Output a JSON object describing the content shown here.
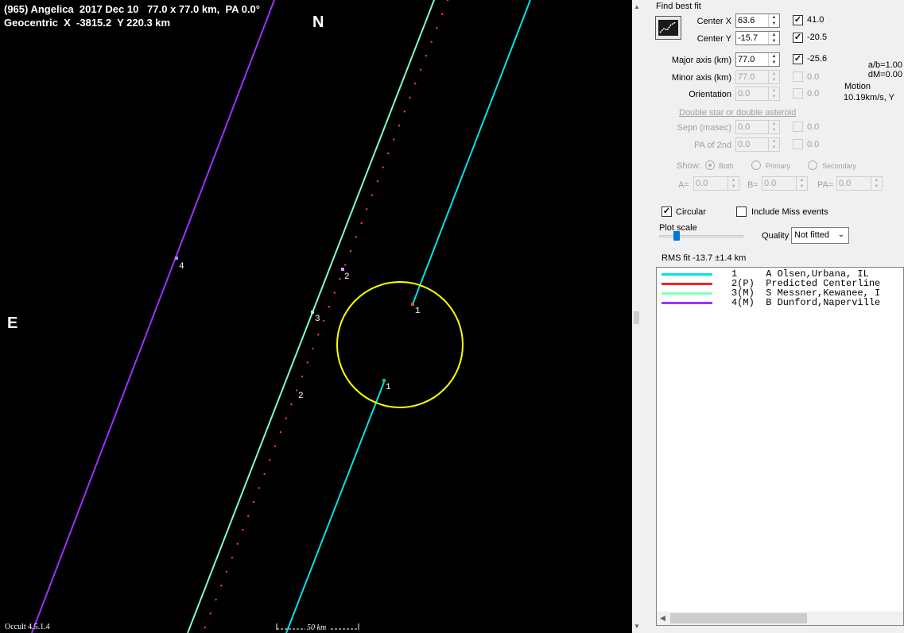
{
  "plot": {
    "title_line1": "(965) Angelica  2017 Dec 10   77.0 x 77.0 km,  PA 0.0°",
    "title_line2": "Geocentric  X  -3815.2  Y 220.3 km",
    "north": "N",
    "east": "E",
    "version": "Occult 4.5.1.4",
    "scale_label": "50 km",
    "chord_labels": {
      "chord4": "4",
      "chord3": "3",
      "pred_top": "2",
      "pred_bottom": "2",
      "chord1_top": "1",
      "chord1_bottom": "1"
    },
    "colors": {
      "chord1": "#00e5e5",
      "predicted": "#ff3030",
      "chord3": "#7fffc4",
      "chord4": "#9933ff",
      "ellipse": "#ffff00"
    }
  },
  "panel": {
    "find_best_fit": "Find best fit",
    "center_x": {
      "label": "Center X",
      "value": "63.6",
      "checked": true,
      "fit": "41.0"
    },
    "center_y": {
      "label": "Center Y",
      "value": "-15.7",
      "checked": true,
      "fit": "-20.5"
    },
    "major_axis": {
      "label": "Major axis (km)",
      "value": "77.0",
      "checked": true,
      "fit": "-25.6"
    },
    "minor_axis": {
      "label": "Minor axis (km)",
      "value": "77.0",
      "checked": false,
      "fit": "0.0"
    },
    "orientation": {
      "label": "Orientation",
      "value": "0.0",
      "checked": false,
      "fit": "0.0"
    },
    "ab": "a/b=1.00",
    "dm": "dM=0.00",
    "motion_label": "Motion",
    "motion_value": "10.19km/s, Y",
    "double_star_title": "Double star  or  double asteroid",
    "sepn": {
      "label": "Sepn (masec)",
      "value": "0.0",
      "fit": "0.0"
    },
    "pa2nd": {
      "label": "PA of 2nd",
      "value": "0.0",
      "fit": "0.0"
    },
    "show_label": "Show:",
    "show_options": [
      "Both",
      "Primary",
      "Secondary"
    ],
    "a_label": "A=",
    "a_value": "0.0",
    "b_label": "B=",
    "b_value": "0.0",
    "pa_label": "PA=",
    "pa_value": "0.0",
    "circular_label": "Circular",
    "circular_checked": true,
    "miss_label": "Include Miss events",
    "miss_checked": false,
    "plot_scale_label": "Plot scale",
    "quality_label": "Quality",
    "quality_value": "Not fitted",
    "rms_fit": "RMS fit  -13.7 ±1.4 km",
    "observers": [
      {
        "text": "1     A Olsen,Urbana, IL",
        "color": "#00e5e5"
      },
      {
        "text": "2(P)  Predicted Centerline",
        "color": "#ff2020"
      },
      {
        "text": "3(M)  S Messner,Kewanee, I",
        "color": "#7fffc4"
      },
      {
        "text": "4(M)  B Dunford,Naperville",
        "color": "#9933ff"
      }
    ]
  }
}
